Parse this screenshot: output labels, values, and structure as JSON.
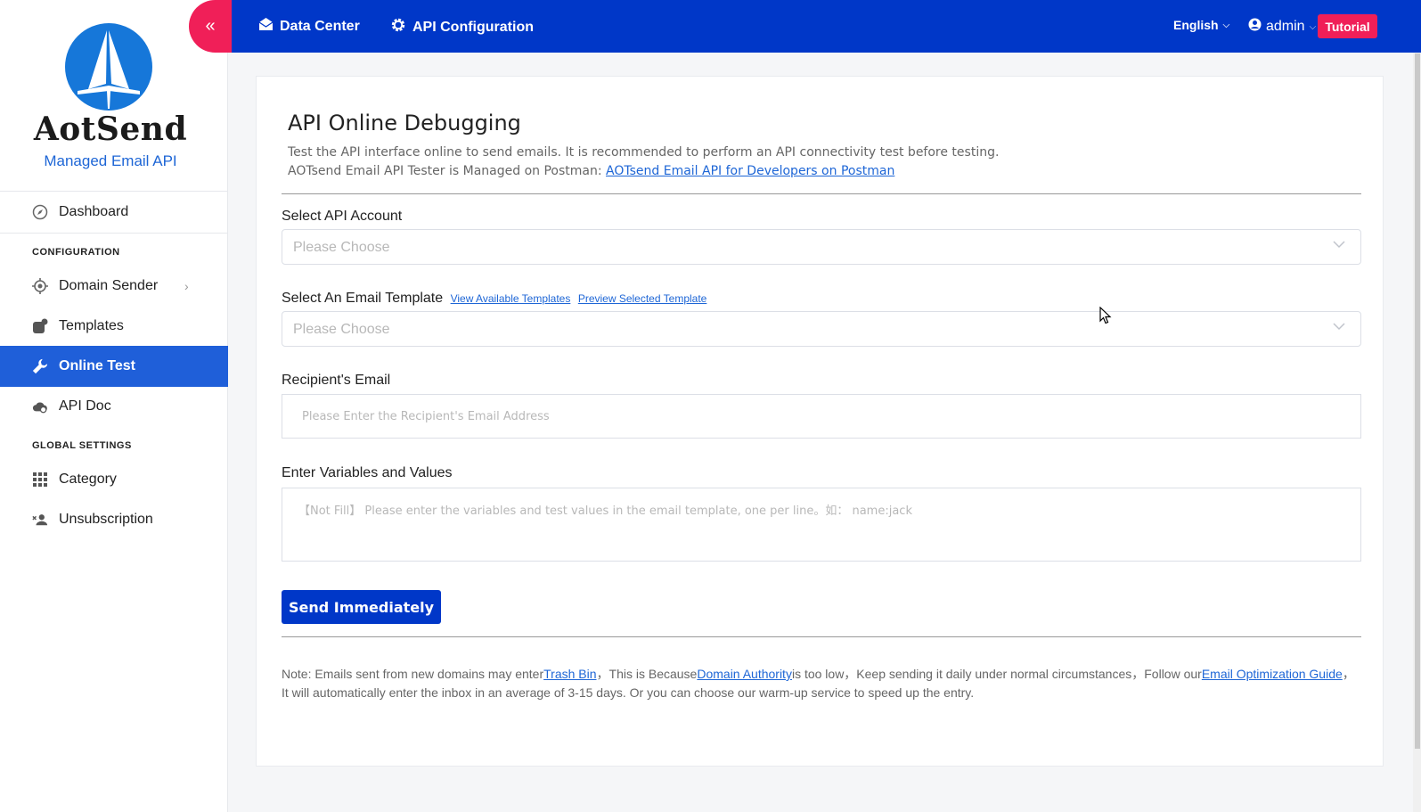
{
  "brand": {
    "name": "AotSend",
    "tagline": "Managed Email API"
  },
  "sidebar": {
    "items": [
      {
        "label": "Dashboard",
        "icon": "compass-icon"
      },
      {
        "label": "Domain Sender",
        "icon": "target-icon"
      },
      {
        "label": "Templates",
        "icon": "templates-icon"
      },
      {
        "label": "Online Test",
        "icon": "wrench-icon"
      },
      {
        "label": "API Doc",
        "icon": "cloud-icon"
      },
      {
        "label": "Category",
        "icon": "grid-icon"
      },
      {
        "label": "Unsubscription",
        "icon": "user-remove-icon"
      }
    ],
    "sections": [
      "CONFIGURATION",
      "GLOBAL SETTINGS"
    ],
    "active": "Online Test"
  },
  "topbar": {
    "links": [
      "Data Center",
      "API Configuration"
    ],
    "language": "English",
    "user": "admin",
    "tutorial": "Tutorial",
    "collapse_icon": "«"
  },
  "page": {
    "title": "API Online Debugging",
    "desc1": "Test the API interface online to send emails. It is recommended to perform an API connectivity test before testing.",
    "desc2_prefix": "AOTsend Email API Tester is Managed on Postman:",
    "desc2_link": "AOTsend Email API for Developers on Postman",
    "form": {
      "account_label": "Select API Account",
      "account_placeholder": "Please Choose",
      "template_label": "Select An Email Template",
      "template_link1": "View Available Templates",
      "template_link2": "Preview Selected Template",
      "template_placeholder": "Please Choose",
      "recipient_label": "Recipient's Email",
      "recipient_placeholder": "Please Enter the Recipient's Email Address",
      "variables_label": "Enter Variables and Values",
      "variables_placeholder": "【Not Fill】 Please enter the variables and test values in the email template, one per line。如： name:jack",
      "send_button": "Send Immediately"
    },
    "note": {
      "part1": "Note: Emails sent from new domains may enter",
      "link1": "Trash Bin",
      "part2": "，This is Because",
      "link2": "Domain Authority",
      "part3": "is too low，Keep sending it daily under normal circumstances，Follow our",
      "link3": "Email Optimization Guide",
      "part4": "，It will automatically enter the inbox in an average of 3-15 days. Or you can choose our warm-up service to speed up the entry."
    }
  },
  "colors": {
    "primary": "#0037c8",
    "accent": "#f01f58",
    "active_nav": "#1f5fd9",
    "link": "#1e66d6"
  }
}
